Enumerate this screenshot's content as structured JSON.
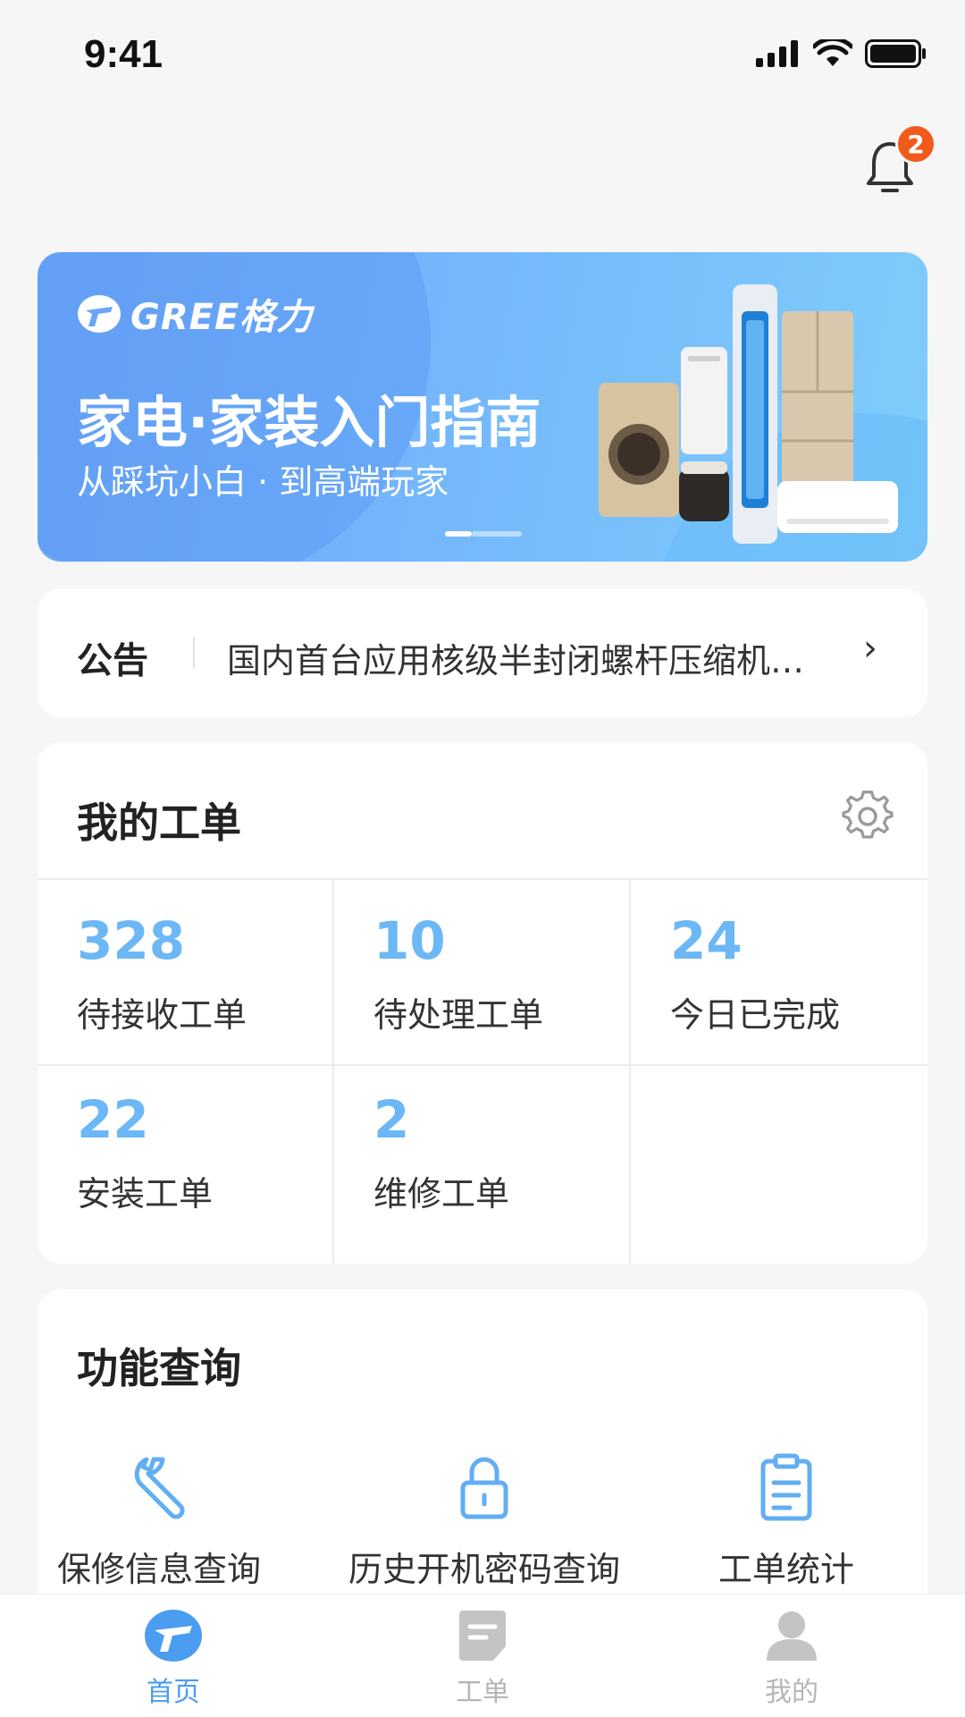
{
  "status_bar": {
    "time": "9:41"
  },
  "notifications": {
    "badge_count": "2"
  },
  "banner": {
    "brand": "GREE格力",
    "title": "家电·家装入门指南",
    "subtitle": "从踩坑小白 · 到高端玩家"
  },
  "notice": {
    "label": "公告",
    "text": "国内首台应用核级半封闭螺杆压缩机…",
    "arrow": "›"
  },
  "orders": {
    "title": "我的工单",
    "stats": [
      {
        "value": "328",
        "label": "待接收工单"
      },
      {
        "value": "10",
        "label": "待处理工单"
      },
      {
        "value": "24",
        "label": "今日已完成"
      },
      {
        "value": "22",
        "label": "安装工单"
      },
      {
        "value": "2",
        "label": "维修工单"
      }
    ]
  },
  "features": {
    "title": "功能查询",
    "items": [
      {
        "label": "保修信息查询",
        "icon": "wrench-icon"
      },
      {
        "label": "历史开机密码查询",
        "icon": "lock-icon"
      },
      {
        "label": "工单统计",
        "icon": "clipboard-icon"
      }
    ]
  },
  "tabbar": {
    "items": [
      {
        "label": "首页",
        "icon": "home-logo-icon",
        "active": true
      },
      {
        "label": "工单",
        "icon": "document-icon",
        "active": false
      },
      {
        "label": "我的",
        "icon": "user-icon",
        "active": false
      }
    ]
  },
  "colors": {
    "accent": "#4a9df0",
    "number_blue": "#6cb7f6",
    "badge": "#f05a1a"
  }
}
